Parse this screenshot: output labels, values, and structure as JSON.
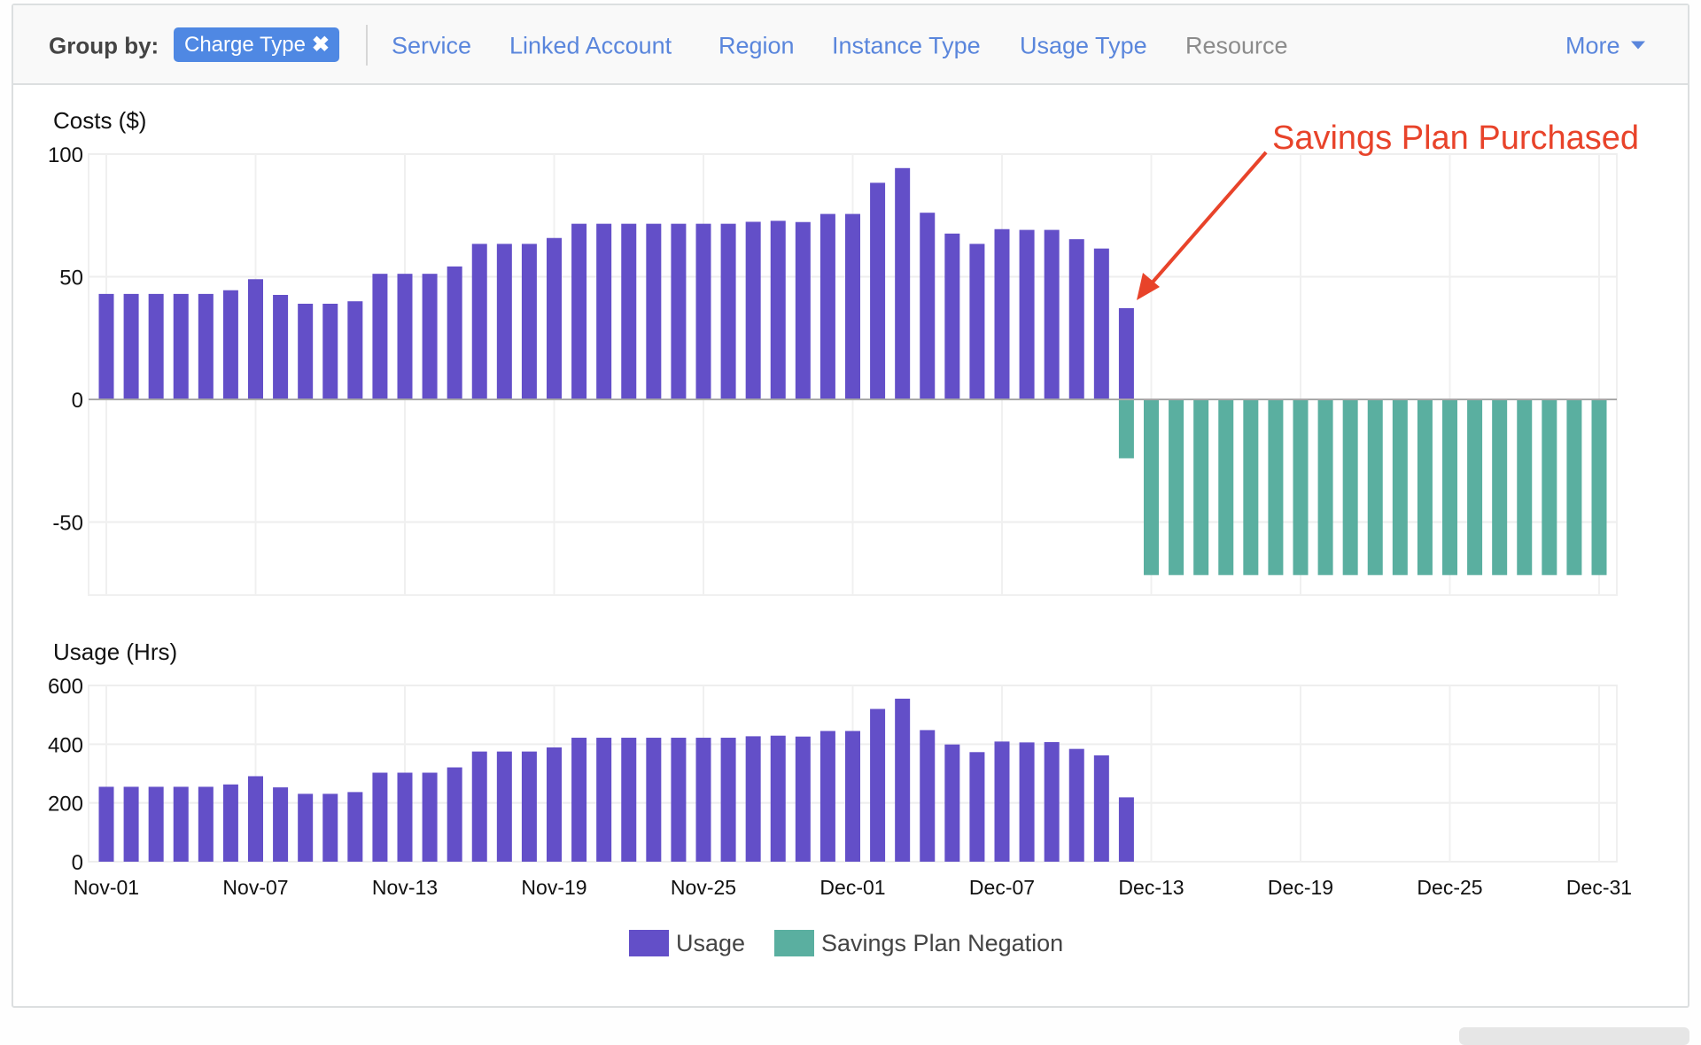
{
  "toolbar": {
    "group_by_label": "Group by:",
    "active_filter": "Charge Type",
    "remove_icon": "close-icon",
    "options": [
      {
        "label": "Service",
        "enabled": true
      },
      {
        "label": "Linked Account",
        "enabled": true
      },
      {
        "label": "Region",
        "enabled": true
      },
      {
        "label": "Instance Type",
        "enabled": true
      },
      {
        "label": "Usage Type",
        "enabled": true
      },
      {
        "label": "Resource",
        "enabled": false
      }
    ],
    "more_label": "More",
    "more_icon": "caret-down-icon"
  },
  "colors": {
    "usage": "#634fc8",
    "savings_plan_negation": "#5aafa0",
    "annotation": "#e8432a",
    "link": "#5a86dc",
    "pill": "#4f88e3"
  },
  "annotation": {
    "text": "Savings Plan Purchased",
    "points_to": "Dec-12"
  },
  "chart_data": [
    {
      "type": "bar",
      "title": "Costs ($)",
      "ylabel": "Costs ($)",
      "xlabel": "",
      "ylim": [
        -80,
        100
      ],
      "yticks": [
        100,
        50,
        0,
        -50
      ],
      "grid": true,
      "x_start": "Nov-01",
      "x_end": "Dec-31",
      "xtick_labels": [
        "Nov-01",
        "Nov-07",
        "Nov-13",
        "Nov-19",
        "Nov-25",
        "Dec-01",
        "Dec-07",
        "Dec-13",
        "Dec-19",
        "Dec-25",
        "Dec-31"
      ],
      "series": [
        {
          "name": "Usage",
          "start": "Nov-01",
          "values": [
            43,
            43,
            43,
            43,
            43,
            44.5,
            49,
            42.6,
            39,
            39,
            40,
            51.2,
            51.2,
            51.2,
            54.2,
            63.4,
            63.4,
            63.4,
            65.8,
            71.6,
            71.6,
            71.6,
            71.6,
            71.6,
            71.6,
            71.6,
            72.4,
            72.8,
            72.3,
            75.6,
            75.6,
            88.3,
            94.3,
            76.1,
            67.6,
            63.4,
            69.4,
            69.1,
            69.1,
            65.3,
            61.5,
            37.2
          ]
        },
        {
          "name": "Savings Plan Negation",
          "start": "Dec-12",
          "values": [
            -24,
            -71.6,
            -71.6,
            -71.6,
            -71.6,
            -71.6,
            -71.6,
            -71.6,
            -71.6,
            -71.6,
            -71.6,
            -71.6,
            -71.6,
            -71.6,
            -71.6,
            -71.6,
            -71.6,
            -71.6,
            -71.6,
            -71.6
          ]
        }
      ]
    },
    {
      "type": "bar",
      "title": "Usage (Hrs)",
      "ylabel": "Usage (Hrs)",
      "xlabel": "",
      "ylim": [
        0,
        600
      ],
      "yticks": [
        600,
        400,
        200,
        0
      ],
      "grid": true,
      "x_start": "Nov-01",
      "x_end": "Dec-31",
      "xtick_labels": [
        "Nov-01",
        "Nov-07",
        "Nov-13",
        "Nov-19",
        "Nov-25",
        "Dec-01",
        "Dec-07",
        "Dec-13",
        "Dec-19",
        "Dec-25",
        "Dec-31"
      ],
      "series": [
        {
          "name": "Usage",
          "start": "Nov-01",
          "values": [
            255,
            255,
            255,
            255,
            255,
            263,
            291,
            253,
            231,
            231,
            237,
            303,
            303,
            303,
            321,
            375,
            375,
            375,
            389,
            422,
            422,
            422,
            422,
            422,
            422,
            422,
            427,
            429,
            426,
            445,
            445,
            520,
            555,
            448,
            399,
            373,
            409,
            406,
            407,
            384,
            362,
            219
          ]
        }
      ]
    }
  ],
  "legend": [
    {
      "label": "Usage",
      "color": "#634fc8"
    },
    {
      "label": "Savings Plan Negation",
      "color": "#5aafa0"
    }
  ]
}
